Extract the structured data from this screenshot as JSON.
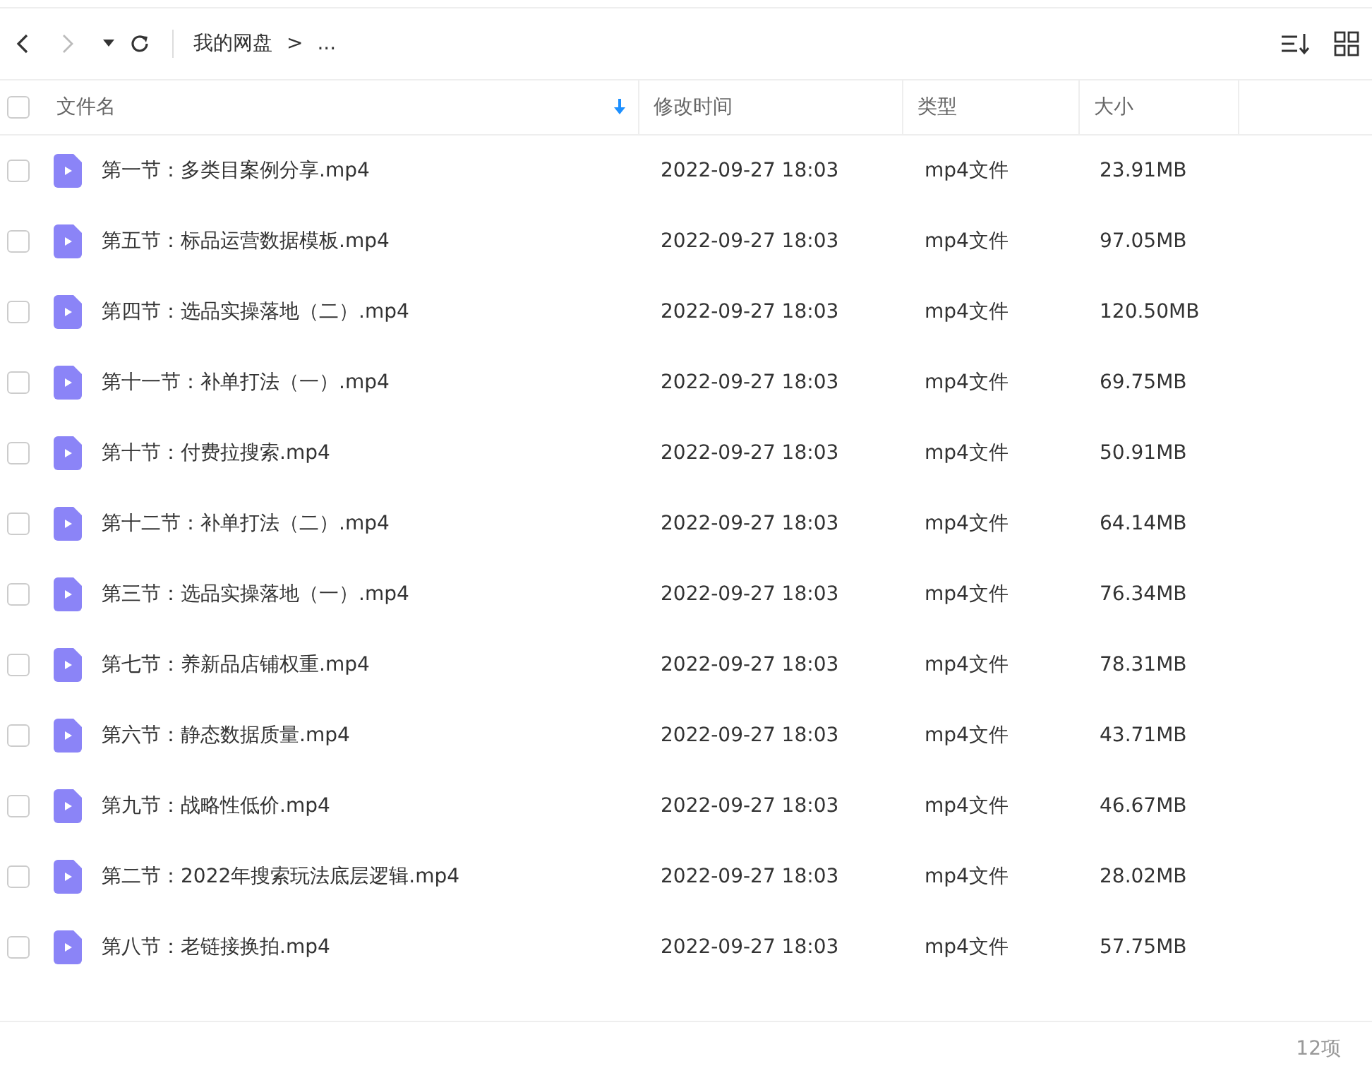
{
  "toolbar": {
    "breadcrumb": [
      {
        "label": "我的网盘"
      },
      {
        "label": ">"
      },
      {
        "label": "..."
      }
    ]
  },
  "table": {
    "select_all": {
      "checked": false
    },
    "columns": [
      {
        "label": "文件名",
        "sorted": true
      },
      {
        "label": "修改时间",
        "sorted": false
      },
      {
        "label": "类型",
        "sorted": false
      },
      {
        "label": "大小",
        "sorted": false
      }
    ],
    "rows": [
      {
        "name": "第一节：多类目案例分享.mp4",
        "modified": "2022-09-27 18:03",
        "type": "mp4文件",
        "size": "23.91MB",
        "checked": false
      },
      {
        "name": "第五节：标品运营数据模板.mp4",
        "modified": "2022-09-27 18:03",
        "type": "mp4文件",
        "size": "97.05MB",
        "checked": false
      },
      {
        "name": "第四节：选品实操落地（二）.mp4",
        "modified": "2022-09-27 18:03",
        "type": "mp4文件",
        "size": "120.50MB",
        "checked": false
      },
      {
        "name": "第十一节：补单打法（一）.mp4",
        "modified": "2022-09-27 18:03",
        "type": "mp4文件",
        "size": "69.75MB",
        "checked": false
      },
      {
        "name": "第十节：付费拉搜索.mp4",
        "modified": "2022-09-27 18:03",
        "type": "mp4文件",
        "size": "50.91MB",
        "checked": false
      },
      {
        "name": "第十二节：补单打法（二）.mp4",
        "modified": "2022-09-27 18:03",
        "type": "mp4文件",
        "size": "64.14MB",
        "checked": false
      },
      {
        "name": "第三节：选品实操落地（一）.mp4",
        "modified": "2022-09-27 18:03",
        "type": "mp4文件",
        "size": "76.34MB",
        "checked": false
      },
      {
        "name": "第七节：养新品店铺权重.mp4",
        "modified": "2022-09-27 18:03",
        "type": "mp4文件",
        "size": "78.31MB",
        "checked": false
      },
      {
        "name": "第六节：静态数据质量.mp4",
        "modified": "2022-09-27 18:03",
        "type": "mp4文件",
        "size": "43.71MB",
        "checked": false
      },
      {
        "name": "第九节：战略性低价.mp4",
        "modified": "2022-09-27 18:03",
        "type": "mp4文件",
        "size": "46.67MB",
        "checked": false
      },
      {
        "name": "第二节：2022年搜索玩法底层逻辑.mp4",
        "modified": "2022-09-27 18:03",
        "type": "mp4文件",
        "size": "28.02MB",
        "checked": false
      },
      {
        "name": "第八节：老链接换拍.mp4",
        "modified": "2022-09-27 18:03",
        "type": "mp4文件",
        "size": "57.75MB",
        "checked": false
      }
    ]
  },
  "status_bar": {
    "count": "12项"
  }
}
